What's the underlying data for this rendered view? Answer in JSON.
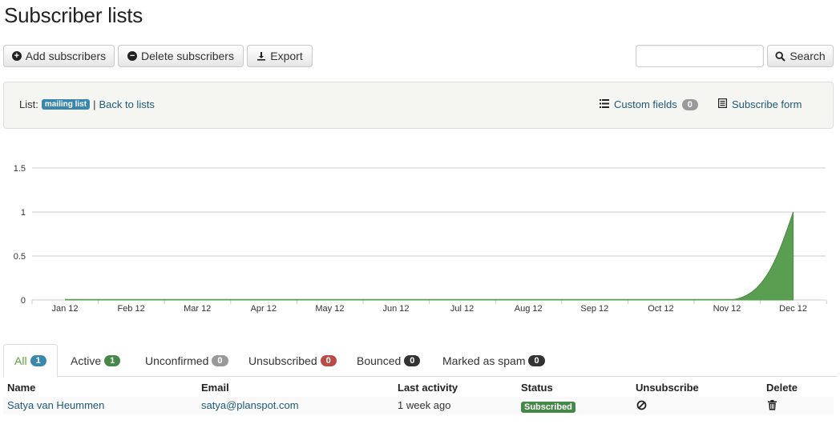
{
  "page": {
    "title": "Subscriber lists"
  },
  "toolbar": {
    "add_label": "Add subscribers",
    "delete_label": "Delete subscribers",
    "export_label": "Export",
    "search_label": "Search",
    "search_value": ""
  },
  "list_info": {
    "list_prefix": "List:",
    "list_name": "mailing list",
    "separator": "|",
    "back_label": "Back to lists",
    "custom_fields_label": "Custom fields",
    "custom_fields_count": "0",
    "subscribe_form_label": "Subscribe form"
  },
  "chart_data": {
    "type": "area",
    "categories": [
      "Jan 12",
      "Feb 12",
      "Mar 12",
      "Apr 12",
      "May 12",
      "Jun 12",
      "Jul 12",
      "Aug 12",
      "Sep 12",
      "Oct 12",
      "Nov 12",
      "Dec 12"
    ],
    "values": [
      0,
      0,
      0,
      0,
      0,
      0,
      0,
      0,
      0,
      0,
      0,
      1
    ],
    "yticks": [
      "0",
      "0.5",
      "1",
      "1.5"
    ],
    "ylim": [
      0,
      1.5
    ],
    "grid": true,
    "color": "#5a9e52"
  },
  "tabs": [
    {
      "label": "All",
      "count": "1",
      "color": "#3a87ad",
      "active": true
    },
    {
      "label": "Active",
      "count": "1",
      "color": "#468847",
      "active": false
    },
    {
      "label": "Unconfirmed",
      "count": "0",
      "color": "#999999",
      "active": false
    },
    {
      "label": "Unsubscribed",
      "count": "0",
      "color": "#b94a48",
      "active": false
    },
    {
      "label": "Bounced",
      "count": "0",
      "color": "#333333",
      "active": false
    },
    {
      "label": "Marked as spam",
      "count": "0",
      "color": "#333333",
      "active": false
    }
  ],
  "table": {
    "headers": [
      "Name",
      "Email",
      "Last activity",
      "Status",
      "Unsubscribe",
      "Delete"
    ],
    "rows": [
      {
        "name": "Satya van Heummen",
        "email": "satya@planspot.com",
        "last_activity": "1 week ago",
        "status": "Subscribed",
        "unsubscribe_icon": "ban-icon",
        "delete_icon": "trash-icon"
      }
    ]
  }
}
